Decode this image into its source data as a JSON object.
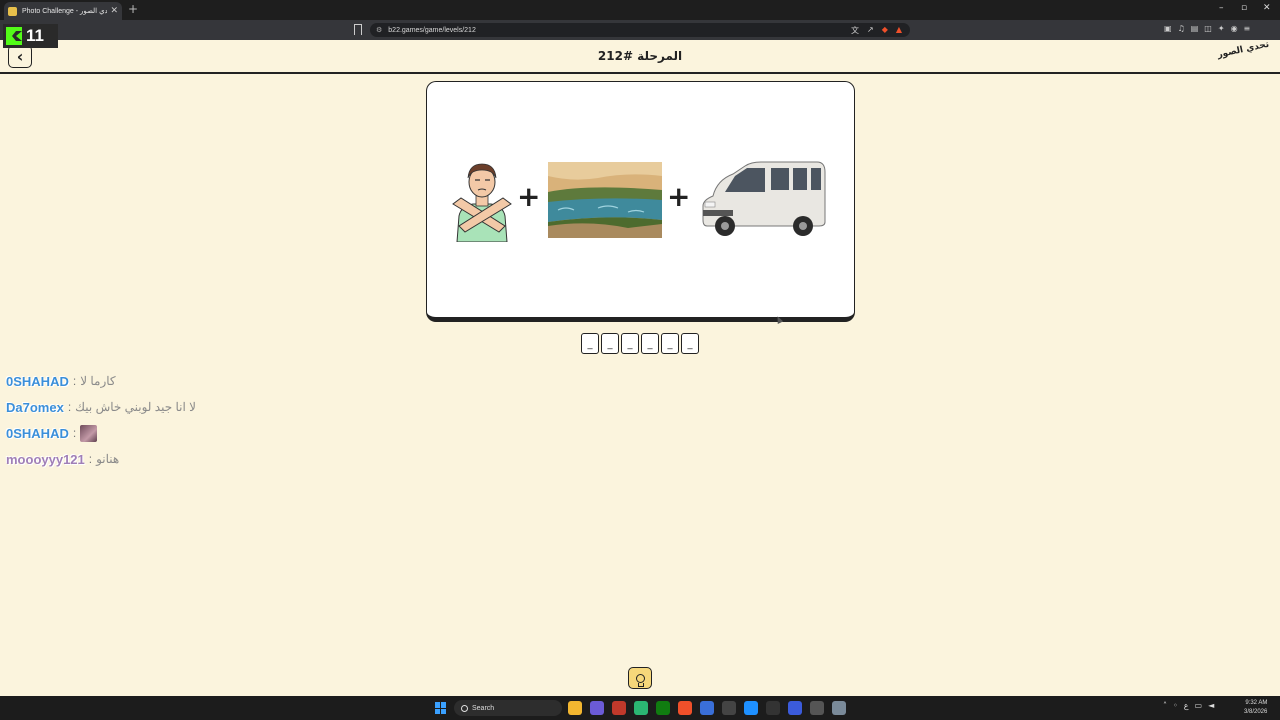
{
  "browser": {
    "tab_title": "Photo Challenge - لعبة تحدي الصور",
    "url": "b22.games/game/levels/212",
    "window_controls": [
      "–",
      "▫",
      "✕"
    ]
  },
  "overlay": {
    "viewer_count": "11"
  },
  "game": {
    "level_title": "المرحلة #212",
    "logo_text": "تحدي الصور",
    "puzzle_pictures": [
      "person-crossed-arms",
      "river-landscape",
      "white-van"
    ],
    "answer_slots": [
      "_",
      "_",
      "_",
      "_",
      "_",
      "_"
    ]
  },
  "chat": [
    {
      "user": "0SHAHAD",
      "message": "كارما لا",
      "color": "#3b8fd9"
    },
    {
      "user": "Da7omex",
      "message": "لا انا جيد لوبني خاش بيك",
      "color": "#3b8fd9"
    },
    {
      "user": "0SHAHAD",
      "message": "",
      "emote": true,
      "color": "#3b8fd9"
    },
    {
      "user": "moooyyy121",
      "message": "هنانو",
      "color": "#a07fb7"
    }
  ],
  "taskbar": {
    "search_label": "Search",
    "time": "9:32 AM",
    "date": "3/8/2026"
  },
  "colors": {
    "page_bg": "#fbf4dd",
    "accent_hint": "#f6d77a",
    "kick_green": "#53fc18"
  }
}
